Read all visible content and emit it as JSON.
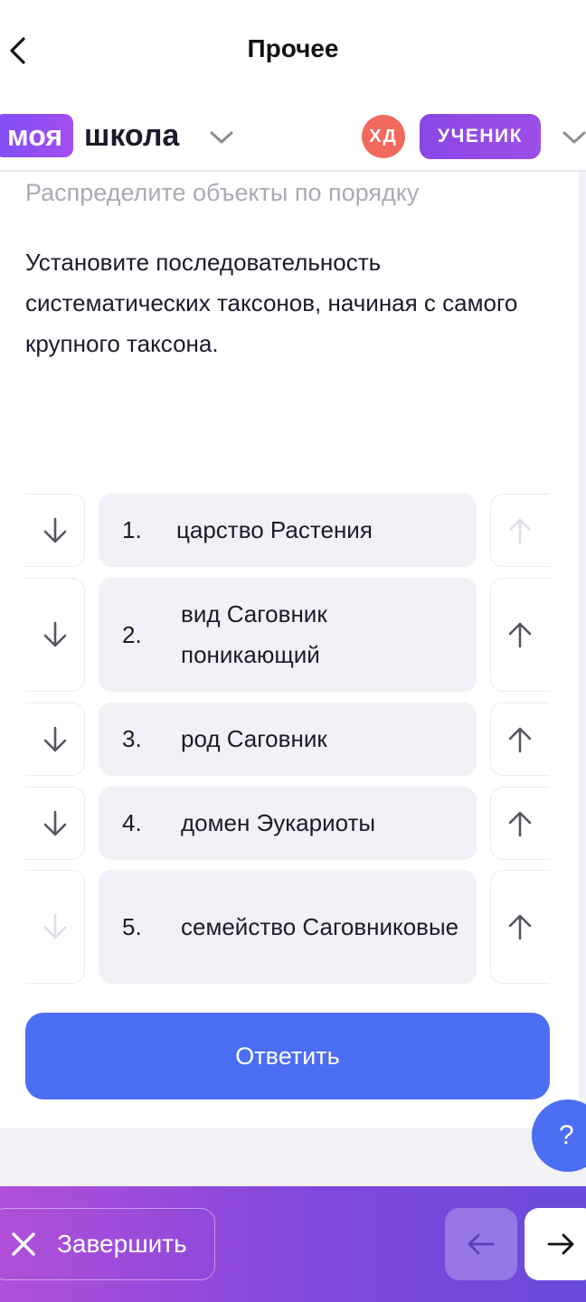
{
  "header": {
    "title": "Прочее",
    "back_icon": "chevron-left-icon",
    "logo_part1": "моя",
    "logo_part2": "школа",
    "avatar_initials": "ХД",
    "role_label": "УЧЕНИК"
  },
  "task": {
    "instruction": "Распределите объекты по порядку",
    "question": "Установите последовательность систематических таксонов, начиная с самого крупного таксона.",
    "items": [
      {
        "number": "1.",
        "text": "царство Растения",
        "down_enabled": true,
        "up_enabled": false
      },
      {
        "number": "2.",
        "text": "вид Саговник поникающий",
        "down_enabled": true,
        "up_enabled": true
      },
      {
        "number": "3.",
        "text": "род Саговник",
        "down_enabled": true,
        "up_enabled": true
      },
      {
        "number": "4.",
        "text": "домен Эукариоты",
        "down_enabled": true,
        "up_enabled": true
      },
      {
        "number": "5.",
        "text": "семейство Саговниковые",
        "down_enabled": false,
        "up_enabled": true
      }
    ],
    "submit_label": "Ответить"
  },
  "help_label": "?",
  "footer": {
    "finish_label": "Завершить",
    "finish_icon": "close-icon",
    "prev_icon": "arrow-left-icon",
    "next_icon": "arrow-right-icon"
  },
  "colors": {
    "accent_blue": "#4c6ef2",
    "brand_purple": "#8a47e6",
    "avatar_red": "#f2695e"
  }
}
